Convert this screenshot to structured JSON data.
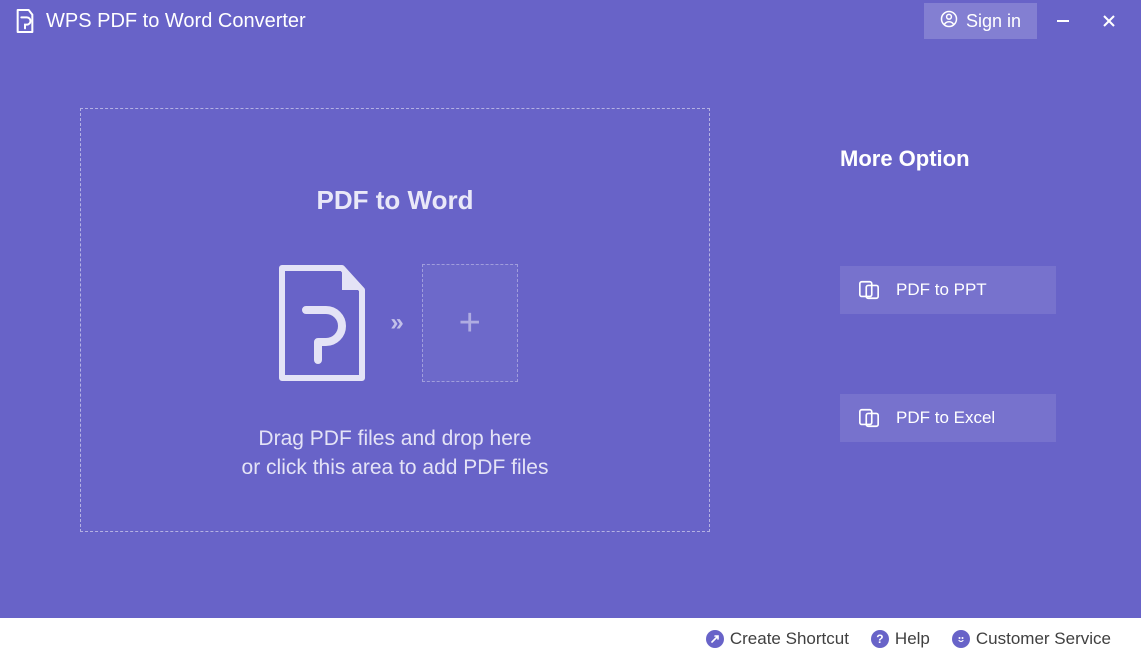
{
  "app": {
    "title": "WPS PDF to Word Converter"
  },
  "titlebar": {
    "signin_label": "Sign in"
  },
  "dropzone": {
    "title": "PDF to Word",
    "instruction_line1": "Drag PDF files and drop here",
    "instruction_line2": "or click this area to add PDF files"
  },
  "sidebar": {
    "heading": "More Option",
    "options": [
      {
        "label": "PDF to PPT"
      },
      {
        "label": "PDF to Excel"
      }
    ]
  },
  "footer": {
    "create_shortcut": "Create Shortcut",
    "help": "Help",
    "customer_service": "Customer Service"
  }
}
